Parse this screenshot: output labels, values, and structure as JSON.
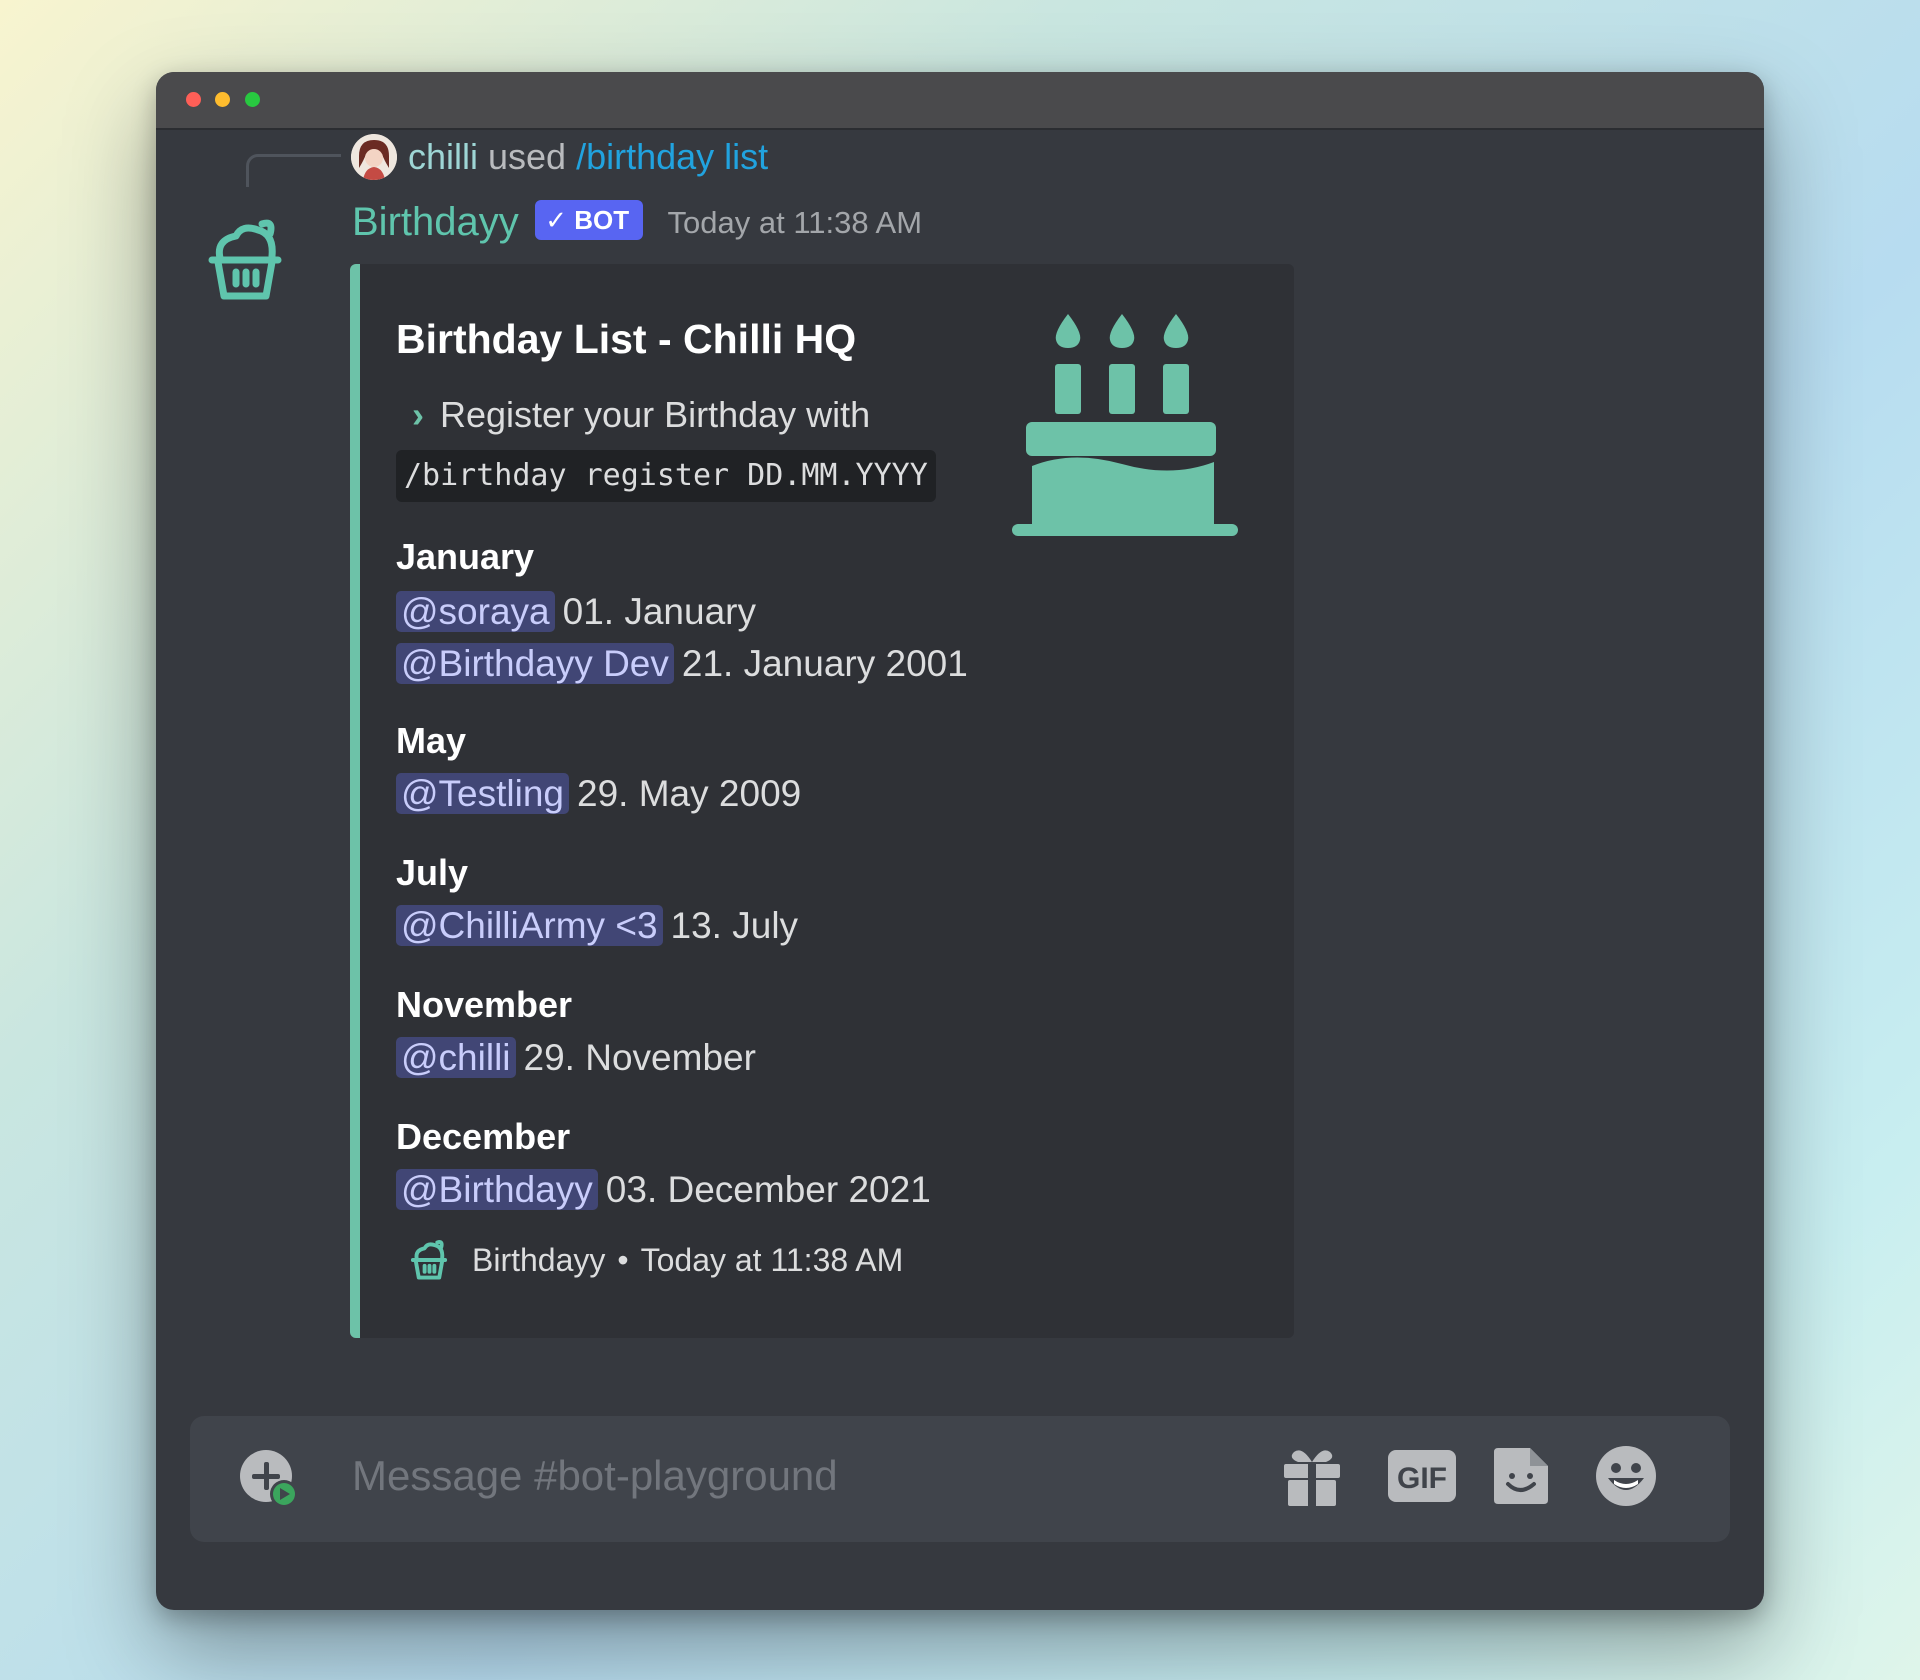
{
  "reply": {
    "username": "chilli",
    "used_text": " used ",
    "command": "/birthday list"
  },
  "message": {
    "bot_name": "Birthdayy",
    "badge": "✓ BOT",
    "timestamp": "Today at 11:38 AM"
  },
  "embed": {
    "accent_color": "#6dc2a8",
    "title": "Birthday List - Chilli HQ",
    "register_text": "Register your Birthday with",
    "register_code": "/birthday register DD.MM.YYYY",
    "months": [
      {
        "name": "January",
        "entries": [
          {
            "mention": "@soraya",
            "date": "01. January"
          },
          {
            "mention": "@Birthdayy Dev",
            "date": "21. January 2001"
          }
        ]
      },
      {
        "name": "May",
        "entries": [
          {
            "mention": "@Testling",
            "date": "29. May 2009"
          }
        ]
      },
      {
        "name": "July",
        "entries": [
          {
            "mention": "@ChilliArmy <3",
            "date": "13. July"
          }
        ]
      },
      {
        "name": "November",
        "entries": [
          {
            "mention": "@chilli",
            "date": "29. November"
          }
        ]
      },
      {
        "name": "December",
        "entries": [
          {
            "mention": "@Birthdayy",
            "date": "03. December 2021"
          }
        ]
      }
    ],
    "footer": {
      "name": "Birthdayy",
      "separator": "•",
      "time": "Today at 11:38 AM"
    }
  },
  "composer": {
    "placeholder": "Message #bot-playground",
    "gif_label": "GIF"
  },
  "icons": {
    "bot_avatar": "cupcake-icon",
    "thumbnail": "birthday-cake-icon",
    "add": "add-plus-circle-icon",
    "gift": "gift-icon",
    "gif": "gif-icon",
    "sticker": "sticker-icon",
    "emoji": "emoji-smile-icon"
  }
}
